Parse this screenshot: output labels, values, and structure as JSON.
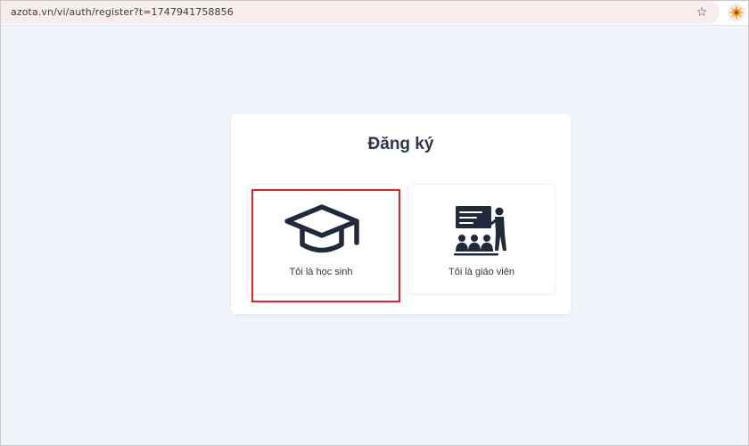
{
  "browser": {
    "url": "azota.vn/vi/auth/register?t=1747941758856",
    "bookmark_icon": "star-outline-icon",
    "extension_icon": "extension-puzzle-icon"
  },
  "register": {
    "title": "Đăng ký",
    "options": [
      {
        "label": "Tôi là học sinh",
        "icon": "graduation-cap-icon"
      },
      {
        "label": "Tôi là giáo viên",
        "icon": "teacher-classroom-icon"
      }
    ]
  },
  "colors": {
    "page_background": "#f1f4fa",
    "icon_dark": "#202a3a",
    "highlight": "#d6262a",
    "title_text": "#2d3748"
  }
}
